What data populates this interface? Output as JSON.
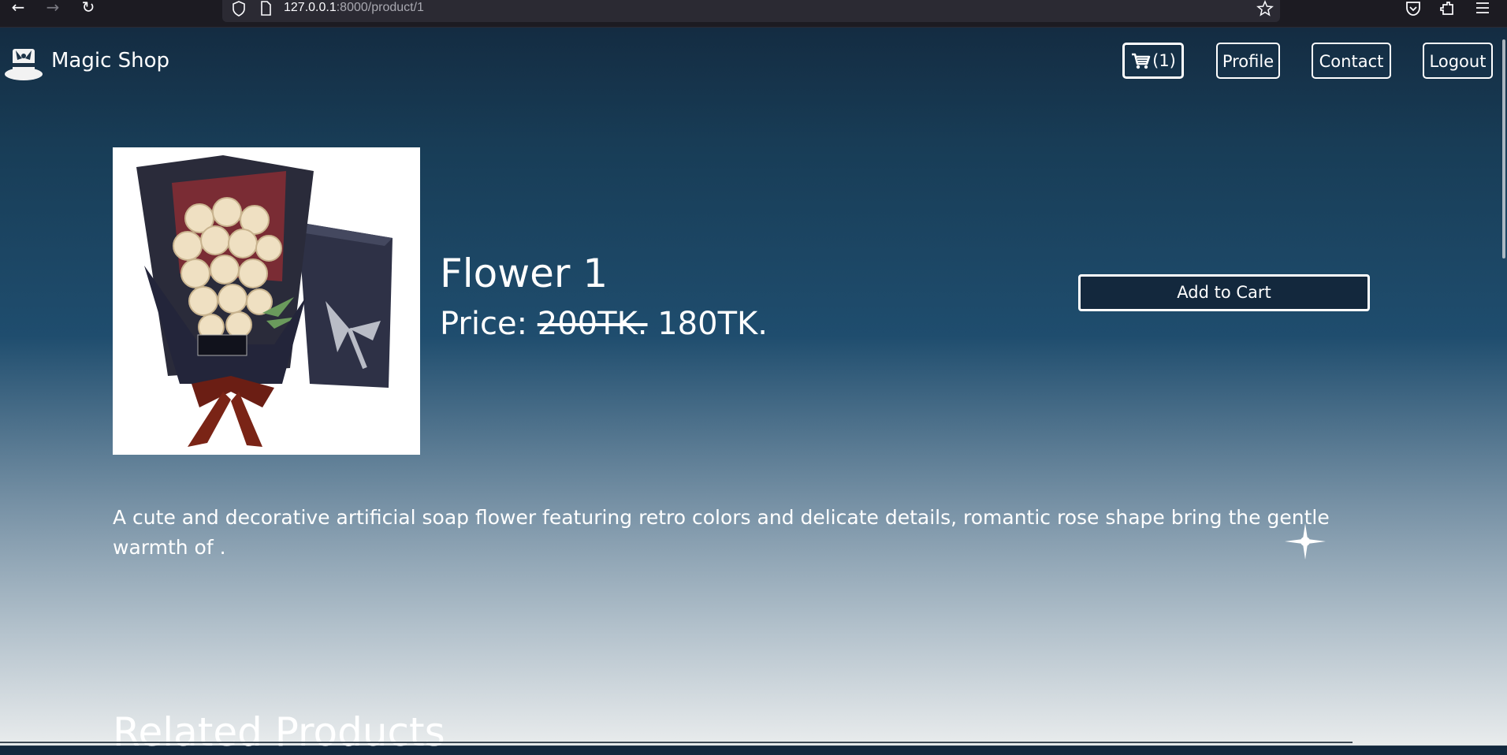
{
  "browser": {
    "url_host": "127.0.0.1",
    "url_path": ":8000/product/1"
  },
  "header": {
    "brand": "Magic Shop",
    "cart_count": "(1)",
    "profile": "Profile",
    "contact": "Contact",
    "logout": "Logout"
  },
  "product": {
    "title": "Flower 1",
    "price_label": "Price:",
    "old_price": "200TK.",
    "new_price": "180TK.",
    "add_to_cart": "Add to Cart",
    "description": "A cute and decorative artificial soap flower featuring retro colors and delicate details, romantic rose shape bring the gentle warmth of ."
  },
  "related": {
    "heading": "Related Products"
  },
  "colors": {
    "page_gradient_top": "#13283d",
    "page_gradient_bottom": "#e9eced",
    "button_fill": "#13283d",
    "text": "#ffffff"
  }
}
